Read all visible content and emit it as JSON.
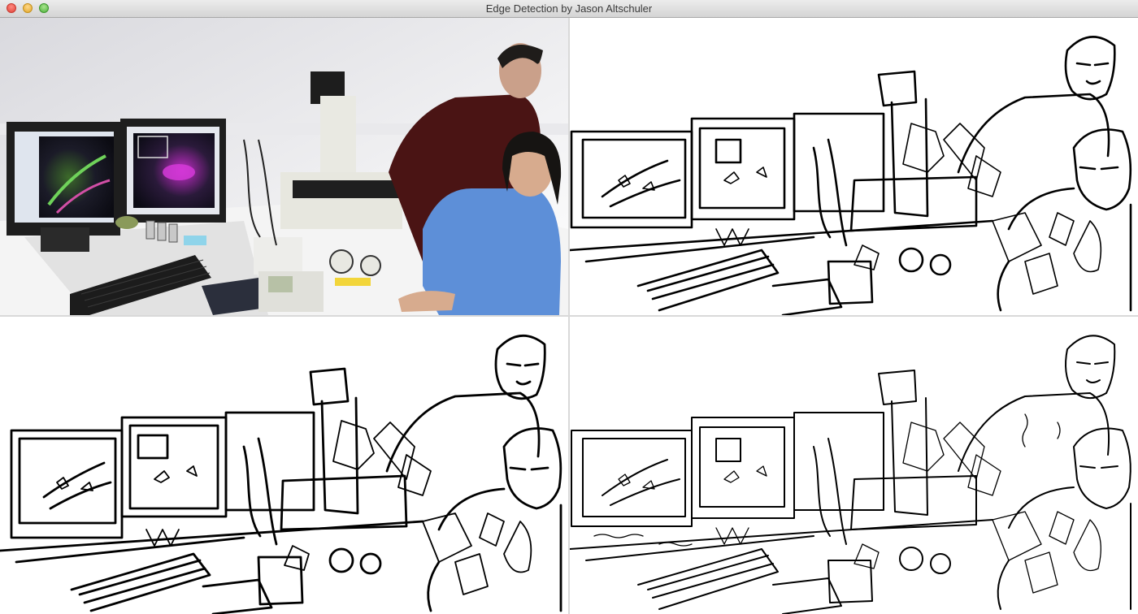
{
  "window": {
    "title": "Edge Detection by Jason Altschuler"
  },
  "panes": [
    {
      "id": "original",
      "kind": "color-photo"
    },
    {
      "id": "edges-1",
      "kind": "edge-map"
    },
    {
      "id": "edges-2",
      "kind": "edge-map"
    },
    {
      "id": "edges-3",
      "kind": "edge-map"
    }
  ]
}
